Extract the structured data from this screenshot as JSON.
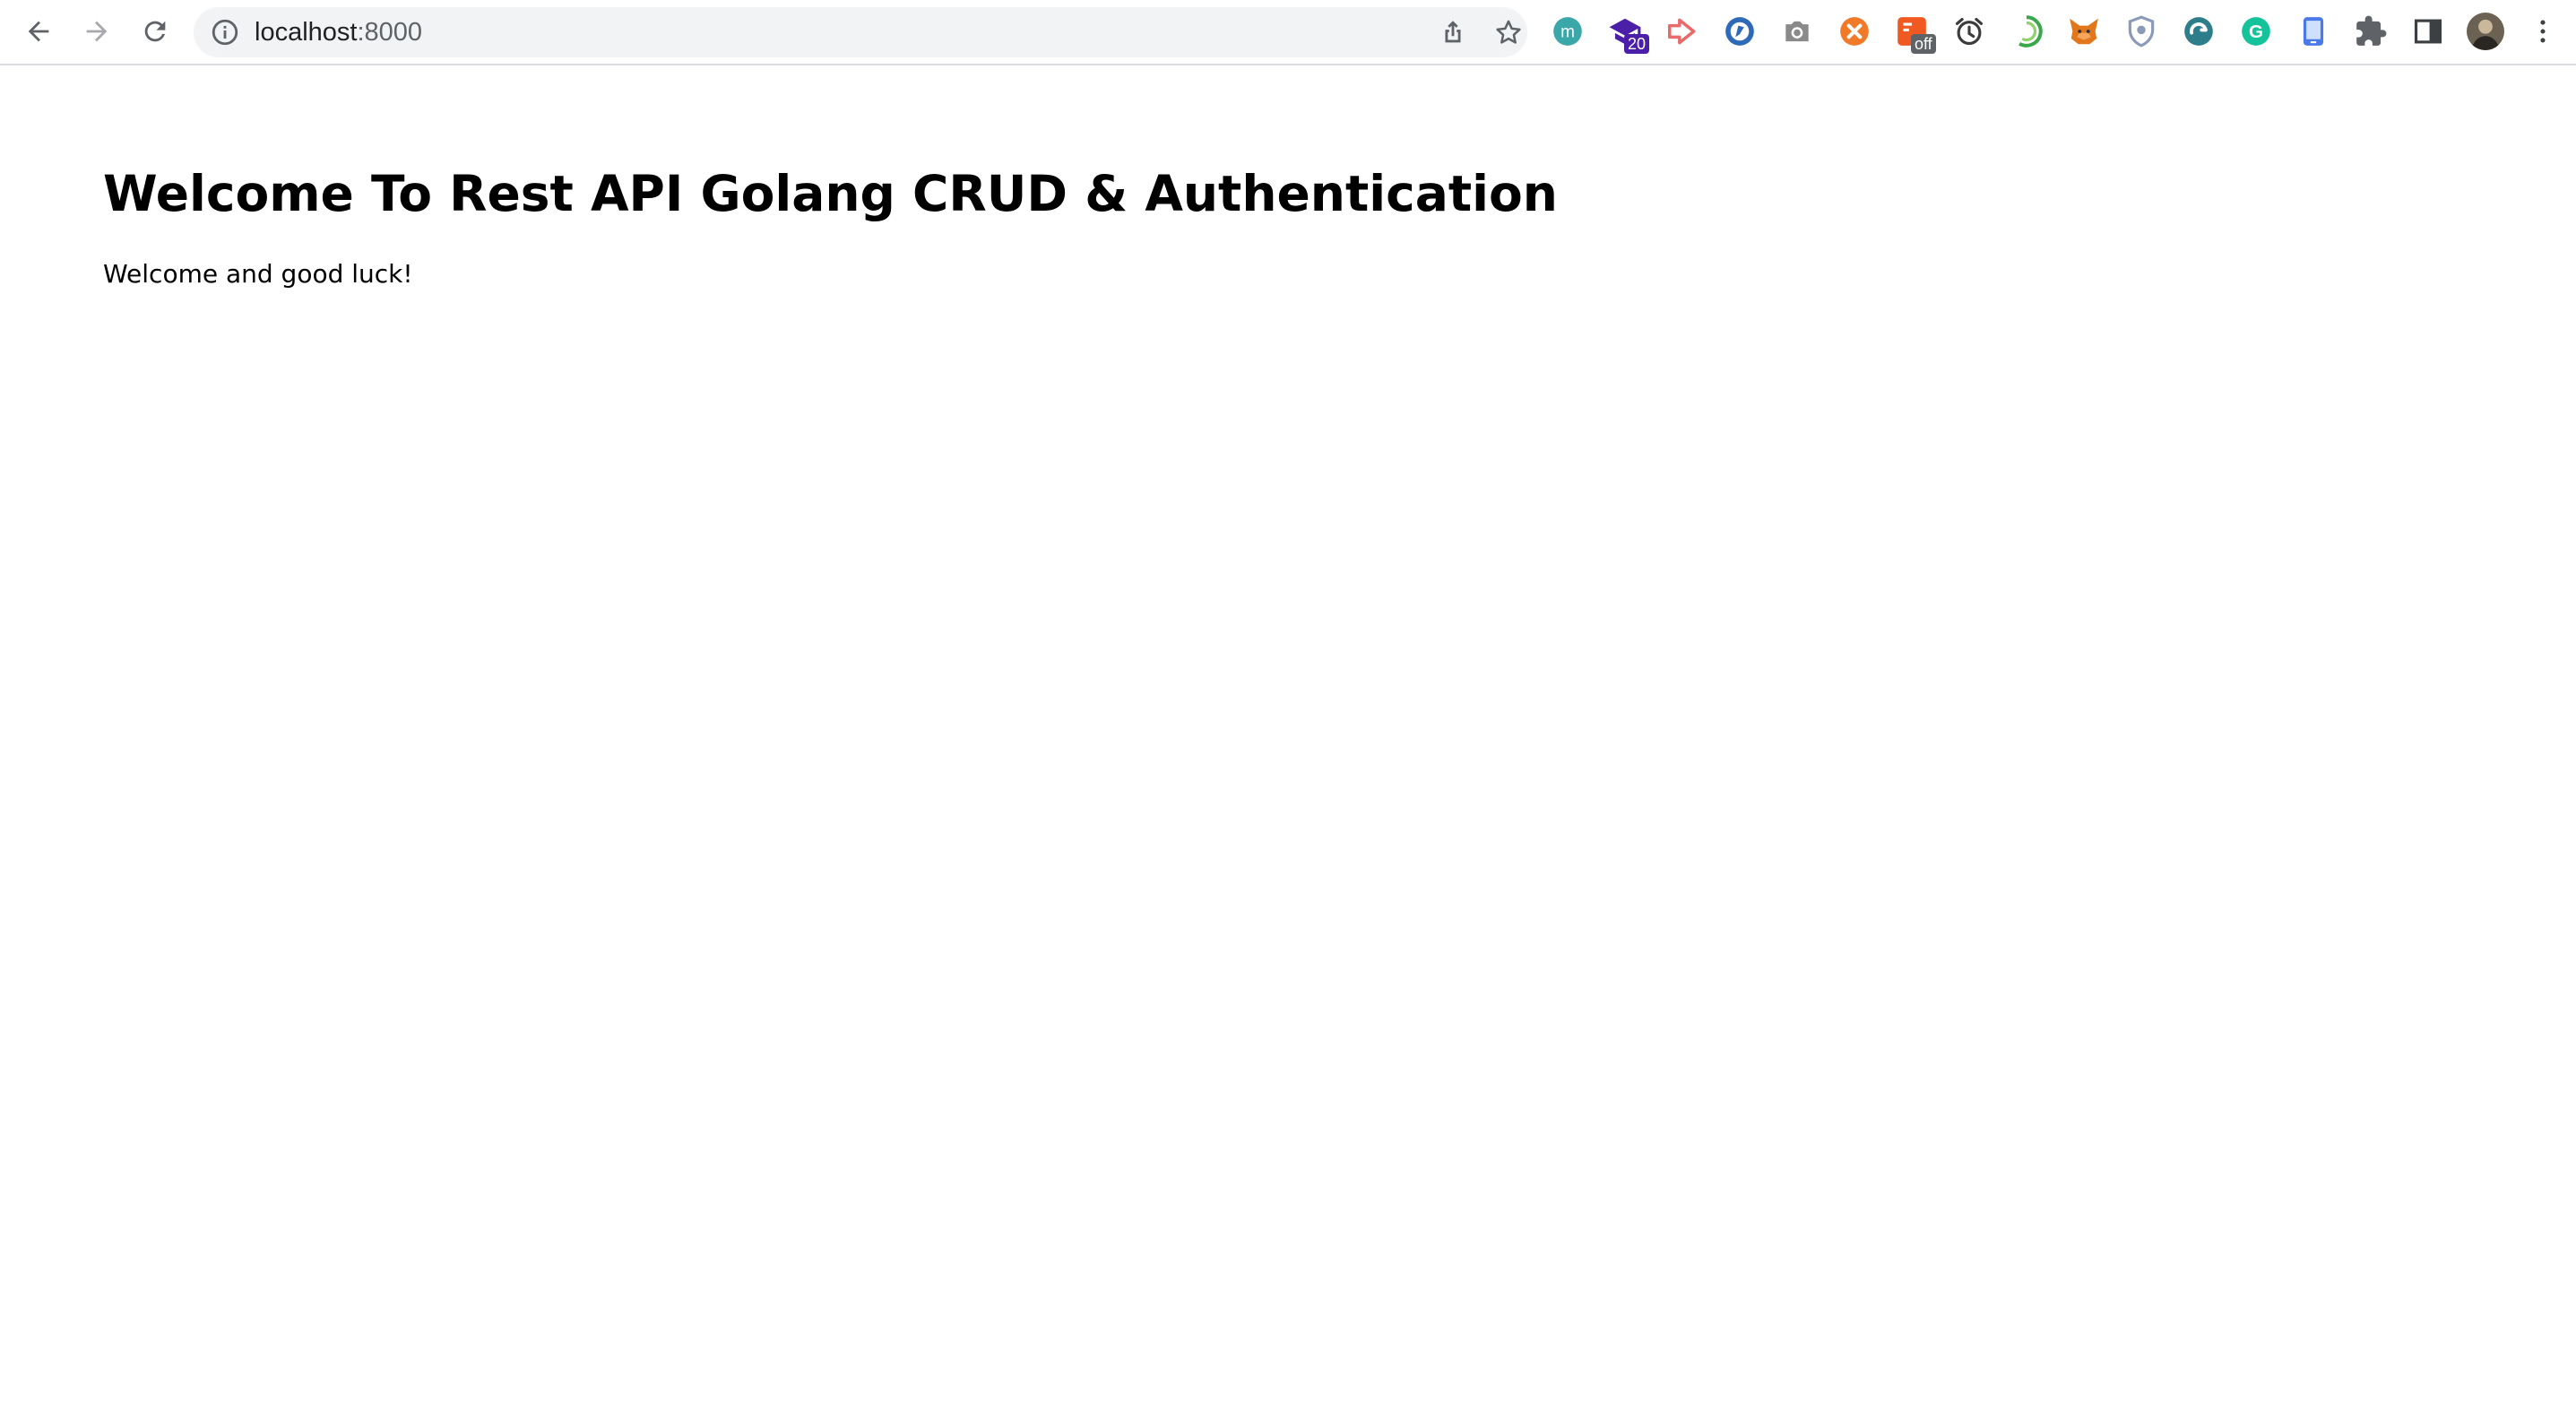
{
  "browser": {
    "url_host": "localhost",
    "url_port": ":8000",
    "extensions": [
      {
        "name": "m-extension-icon",
        "letter": "m",
        "color": "#3aa8a8"
      },
      {
        "name": "graduation-cap-extension-icon",
        "badge": "20",
        "color": "#4b1fa8"
      },
      {
        "name": "red-arrow-extension-icon",
        "color": "#e86a6a"
      },
      {
        "name": "blue-circle-extension-icon",
        "color": "#2d6bb8"
      },
      {
        "name": "camera-extension-icon",
        "color": "#8a8a8a"
      },
      {
        "name": "orange-circle-extension-icon",
        "color": "#f07a28"
      },
      {
        "name": "orange-square-extension-icon",
        "badge": "off",
        "color": "#f05a22"
      },
      {
        "name": "alarm-clock-extension-icon",
        "color": "#3c3c3c"
      },
      {
        "name": "green-ring-extension-icon",
        "color": "#3aa84a"
      },
      {
        "name": "fox-extension-icon",
        "color": "#e2761b"
      },
      {
        "name": "shield-extension-icon",
        "color": "#8a9ab8"
      },
      {
        "name": "teal-circle-extension-icon",
        "color": "#2e7d8a"
      },
      {
        "name": "grammarly-extension-icon",
        "letter": "G",
        "color": "#15c39a"
      },
      {
        "name": "phone-extension-icon",
        "color": "#4a7ae8"
      }
    ],
    "badge_colors": {
      "purple": "#4b1fa8",
      "gray": "#5f6368"
    }
  },
  "page": {
    "heading": "Welcome To Rest API Golang CRUD & Authentication",
    "paragraph": "Welcome and good luck!"
  }
}
